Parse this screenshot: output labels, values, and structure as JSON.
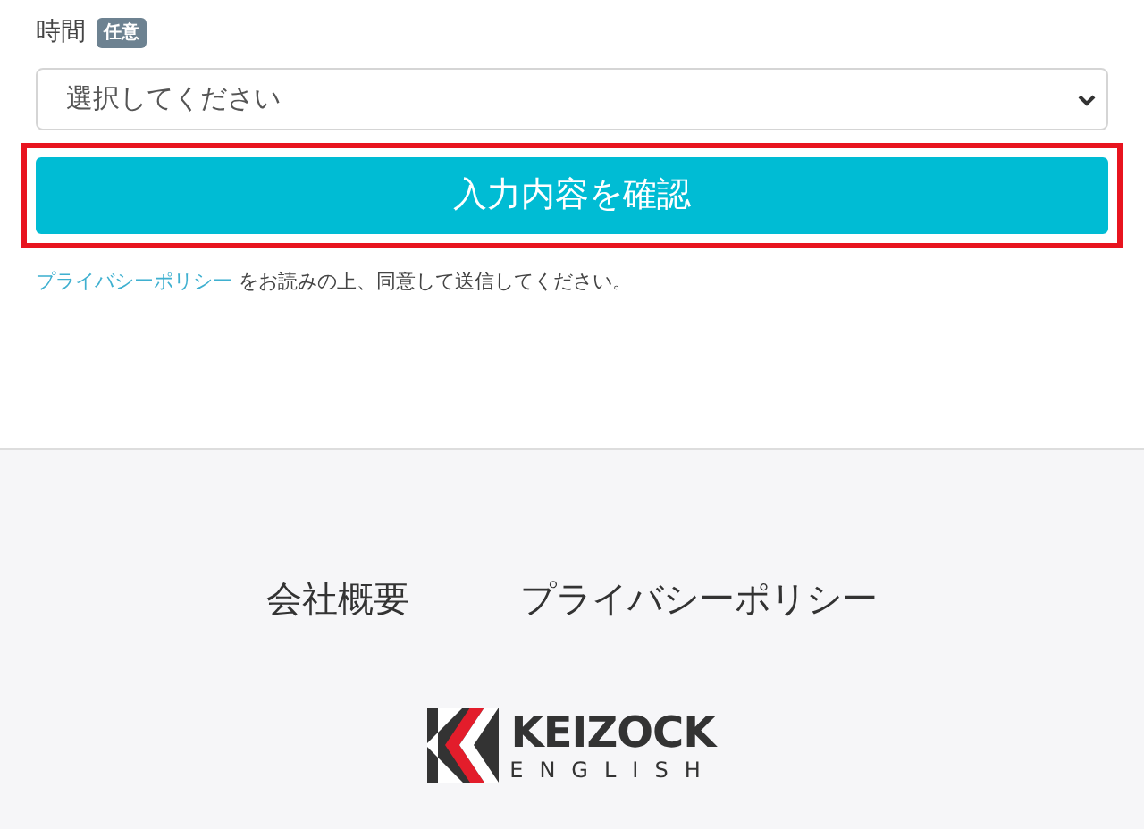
{
  "field": {
    "label": "時間",
    "badge": "任意",
    "placeholder": "選択してください"
  },
  "confirm_button": {
    "label": "入力内容を確認",
    "highlighted": true
  },
  "notice": {
    "link": "プライバシーポリシー",
    "text": "をお読みの上、同意して送信してください。"
  },
  "footer": {
    "links": [
      "会社概要",
      "プライバシーポリシー"
    ],
    "logo": {
      "name": "KEIZOCK",
      "sub": "ENGLISH"
    }
  }
}
